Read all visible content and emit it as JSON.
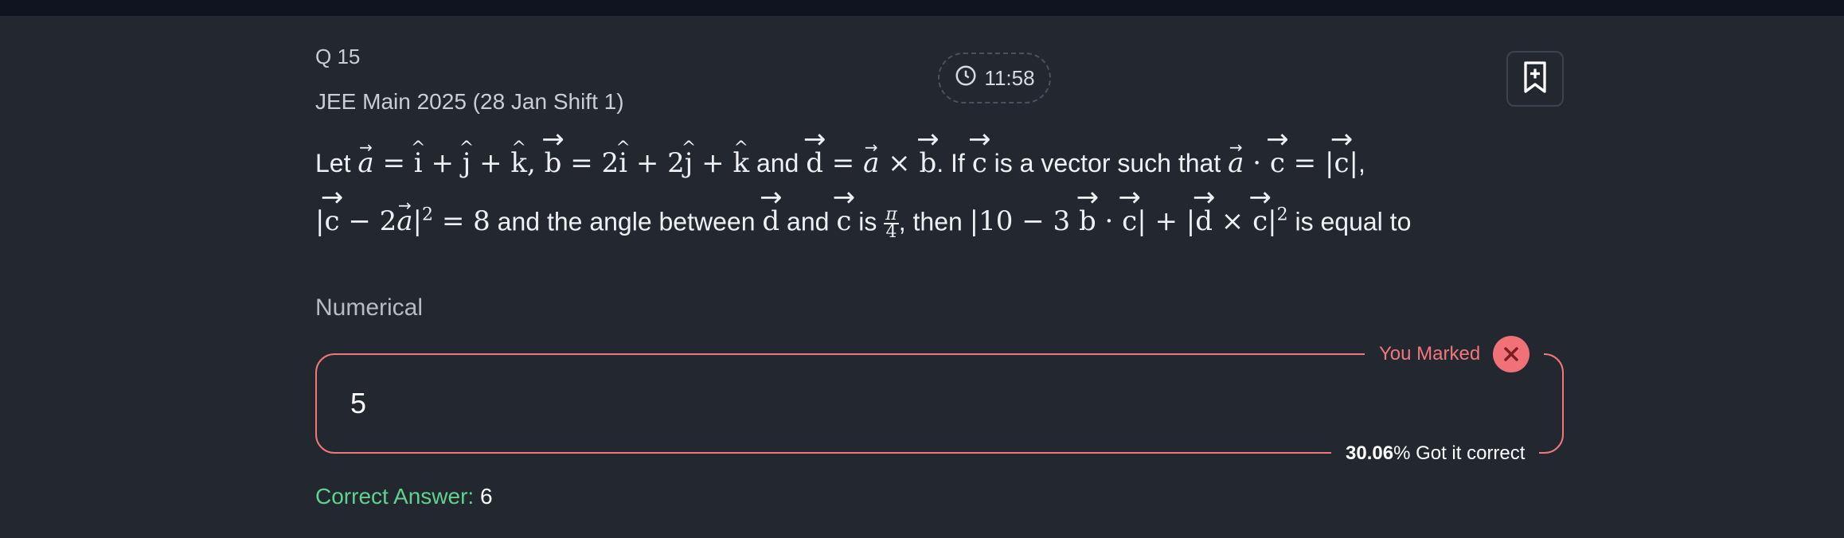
{
  "question": {
    "number_label": "Q 15",
    "exam": "JEE Main 2025 (28 Jan Shift 1)",
    "timer": "11:58",
    "type": "Numerical"
  },
  "question_text": {
    "let": "Let",
    "and": "and",
    "if": ". If",
    "vec_such_that": "is a vector such that",
    "and_angle_between": "and the angle between",
    "is": "is",
    "then": ", then",
    "is_equal_to": "is equal to"
  },
  "answer": {
    "marked_value": "5",
    "you_marked_label": "You Marked",
    "percent": "30.06",
    "percent_suffix": "% Got it correct",
    "correct_label": "Correct Answer:",
    "correct_value": "6"
  },
  "icons": {
    "timer": "clock-icon",
    "bookmark": "bookmark-add-icon",
    "wrong": "close-icon"
  },
  "colors": {
    "background": "#232830",
    "wrong": "#f0787c",
    "correct": "#5fd38d"
  }
}
